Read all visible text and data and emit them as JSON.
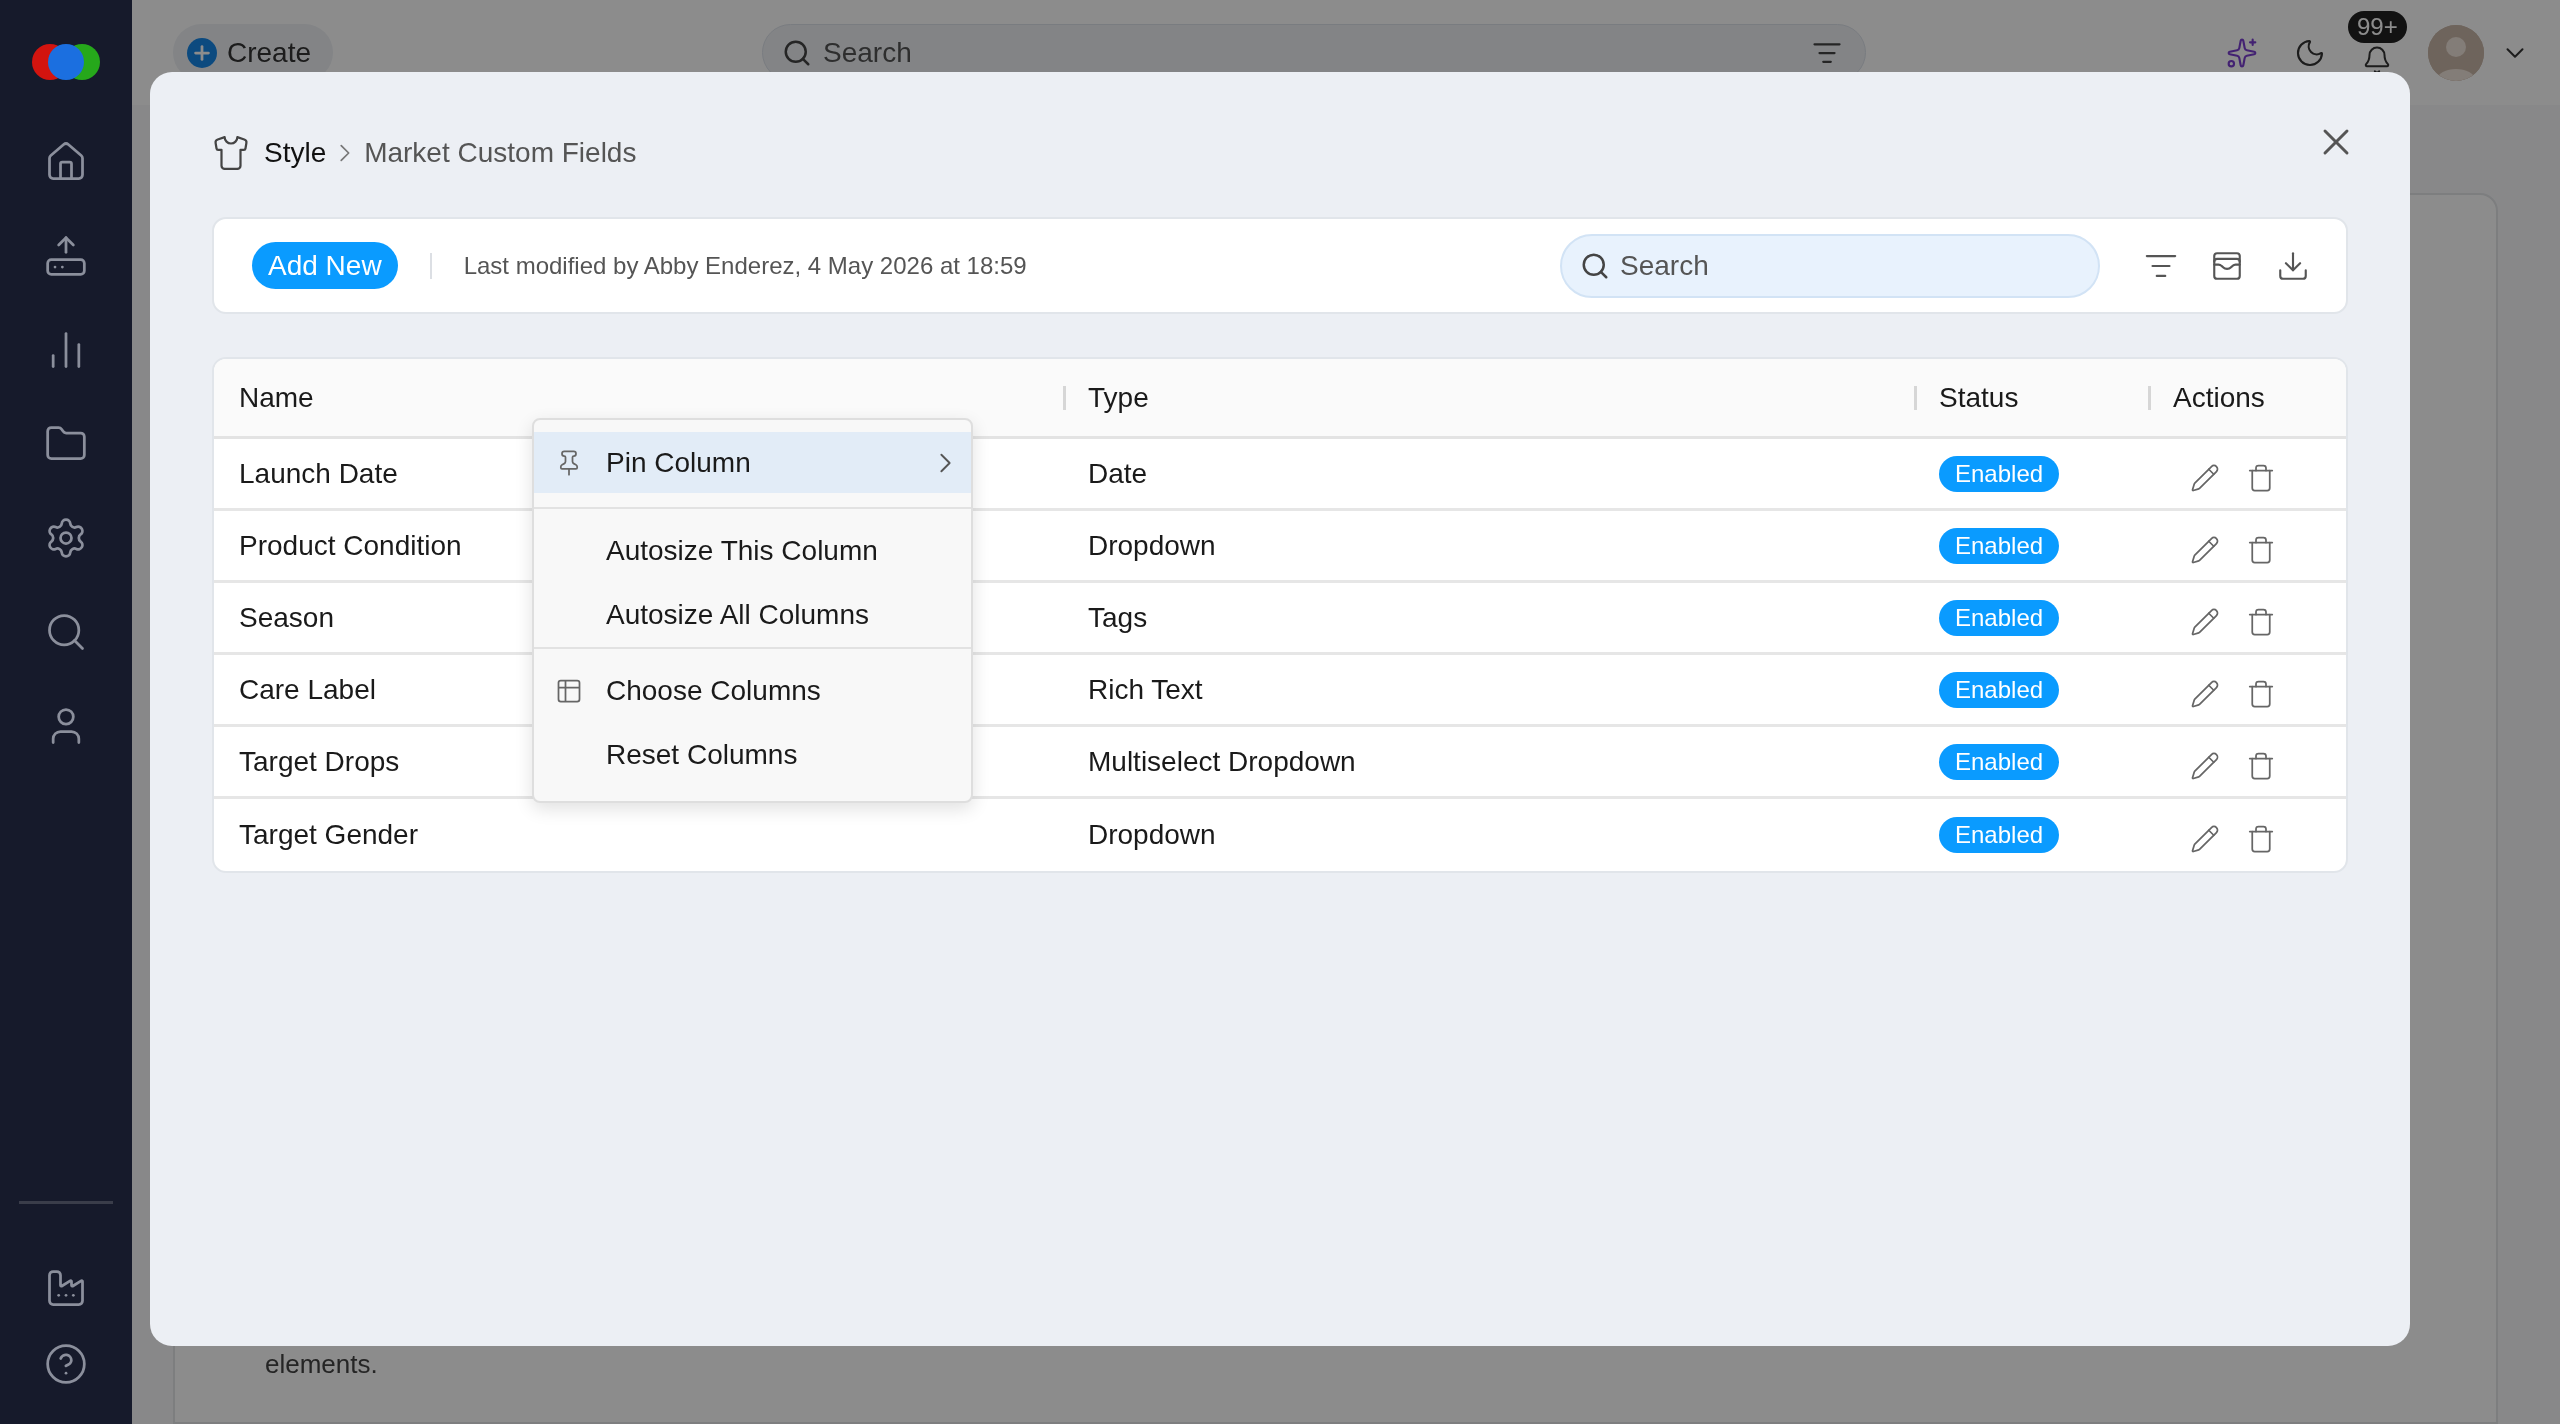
{
  "top_bar": {
    "create_button": "Create",
    "search": {
      "placeholder": "Search"
    },
    "notification_count": "99+"
  },
  "background_text": "elements.",
  "dialog": {
    "breadcrumb": [
      "Style",
      "Market Custom Fields"
    ],
    "toolbar": {
      "add_button": "Add New",
      "last_modified": "Last modified by Abby Enderez, 4 May 2026 at 18:59",
      "search": {
        "placeholder": "Search"
      }
    },
    "table": {
      "columns": [
        "Name",
        "Type",
        "Status",
        "Actions"
      ],
      "rows": [
        {
          "name": "Launch Date",
          "type": "Date",
          "status": "Enabled"
        },
        {
          "name": "Product Condition",
          "type": "Dropdown",
          "status": "Enabled"
        },
        {
          "name": "Season",
          "type": "Tags",
          "status": "Enabled"
        },
        {
          "name": "Care Label",
          "type": "Rich Text",
          "status": "Enabled"
        },
        {
          "name": "Target Drops",
          "type": "Multiselect Dropdown",
          "status": "Enabled"
        },
        {
          "name": "Target Gender",
          "type": "Dropdown",
          "status": "Enabled"
        }
      ]
    },
    "column_menu": {
      "groups": [
        [
          {
            "label": "Pin Column",
            "kind": "submenu",
            "selected": true
          }
        ],
        [
          {
            "label": "Autosize This Column",
            "kind": "action",
            "selected": false
          },
          {
            "label": "Autosize All Columns",
            "kind": "action",
            "selected": false
          }
        ],
        [
          {
            "label": "Choose Columns",
            "kind": "action",
            "selected": false
          },
          {
            "label": "Reset Columns",
            "kind": "action",
            "selected": false
          }
        ]
      ]
    }
  }
}
